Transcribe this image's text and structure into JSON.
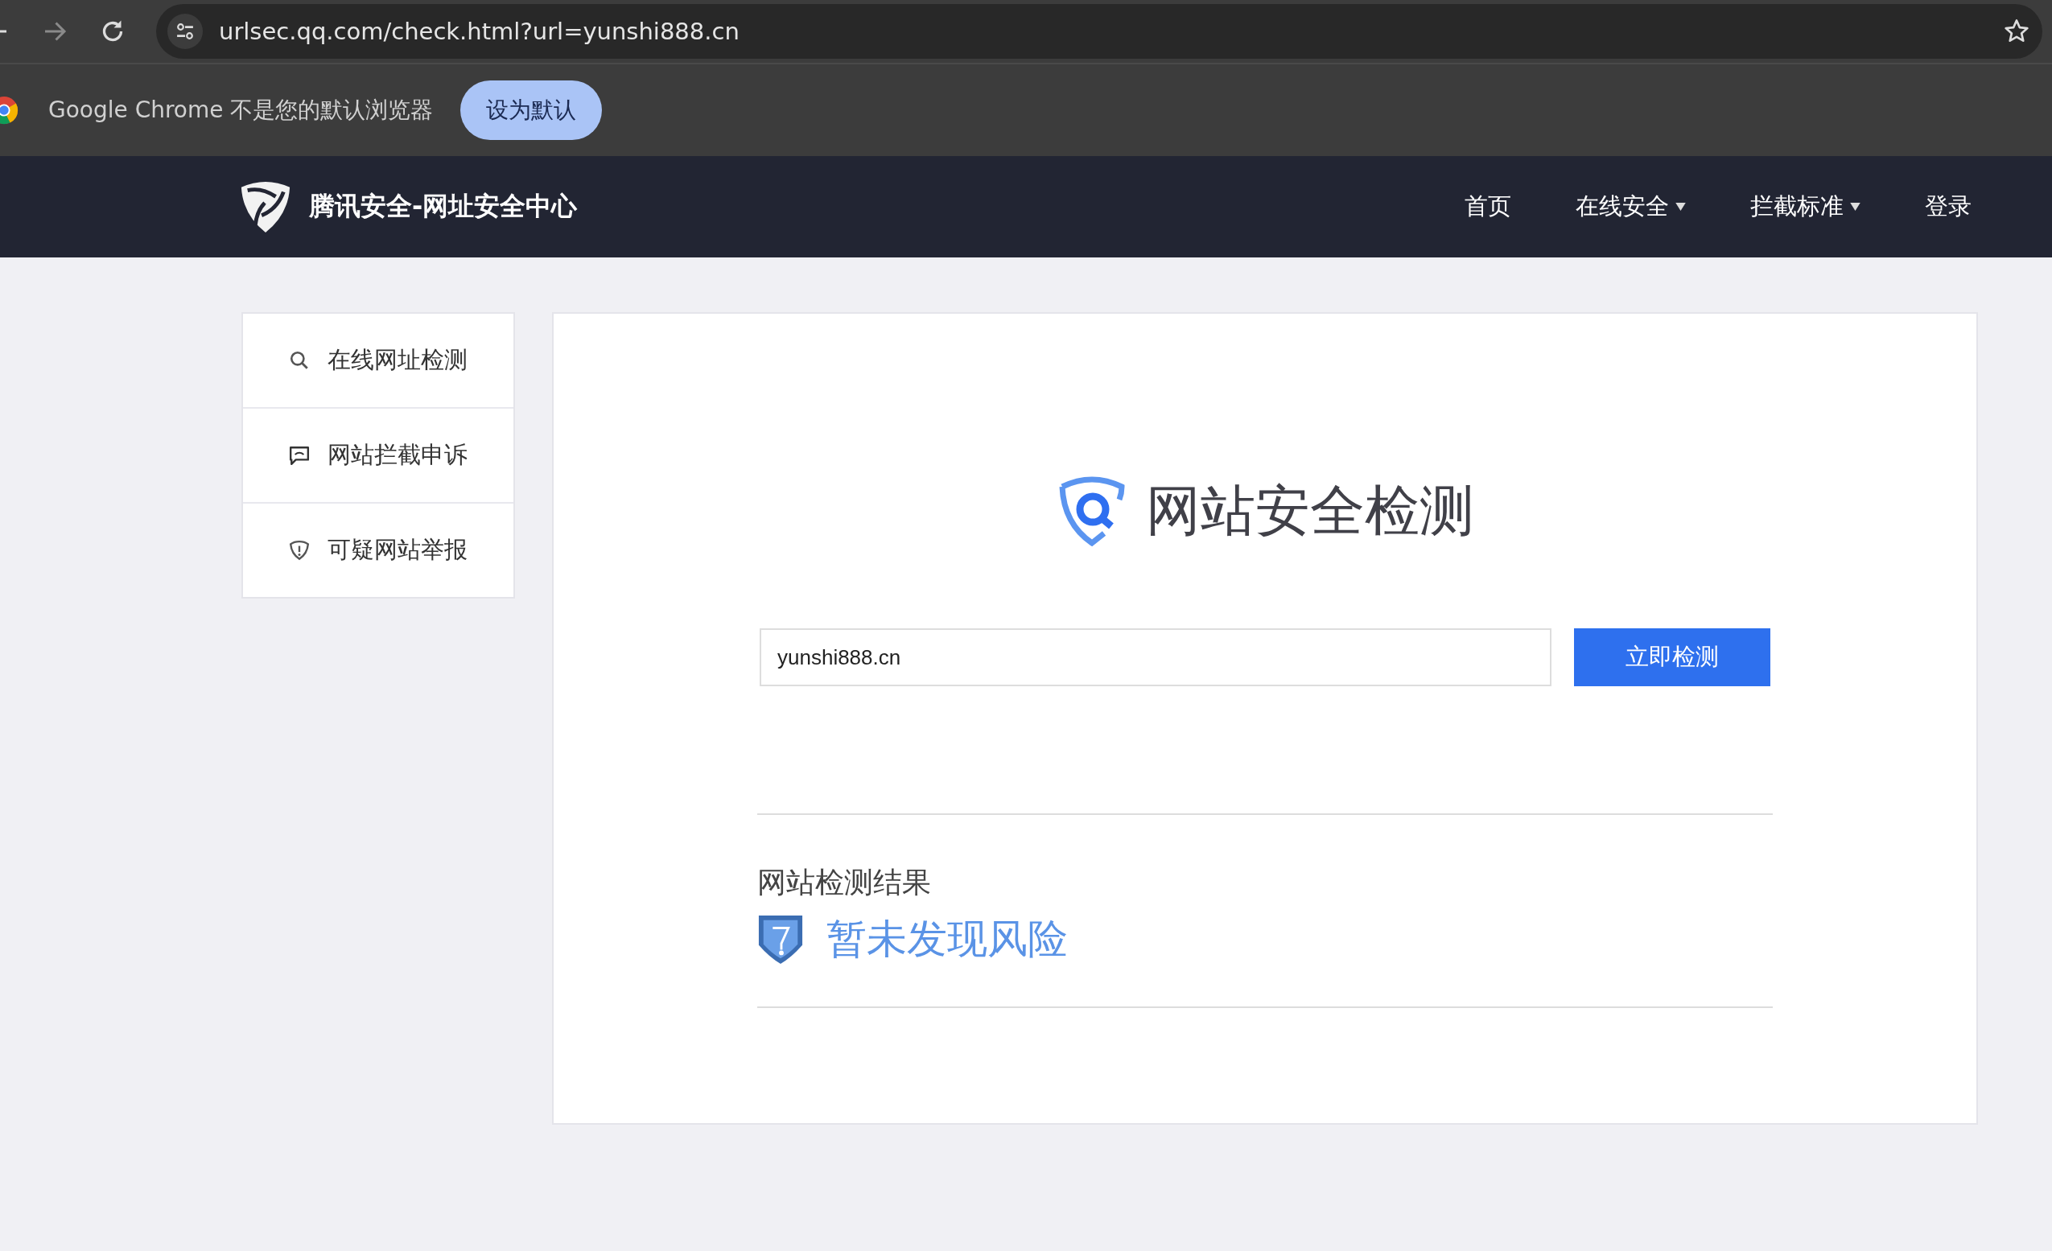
{
  "browser": {
    "url": "urlsec.qq.com/check.html?url=yunshi888.cn",
    "back_disabled": false,
    "forward_disabled": true
  },
  "infobar": {
    "message": "Google Chrome 不是您的默认浏览器",
    "button": "设为默认"
  },
  "site_header": {
    "brand": "腾讯安全-网址安全中心",
    "nav": [
      {
        "label": "首页",
        "kind": "link"
      },
      {
        "label": "在线安全",
        "kind": "dropdown"
      },
      {
        "label": "拦截标准",
        "kind": "dropdown"
      },
      {
        "label": "登录",
        "kind": "link"
      }
    ]
  },
  "sidebar": {
    "items": [
      {
        "label": "在线网址检测",
        "kind": "search"
      },
      {
        "label": "网站拦截申诉",
        "kind": "comment"
      },
      {
        "label": "可疑网站举报",
        "kind": "report"
      }
    ]
  },
  "main": {
    "title": "网站安全检测",
    "url_input": {
      "value": "yunshi888.cn"
    },
    "check_button": "立即检测",
    "result": {
      "heading": "网站检测结果",
      "status": "暂未发现风险"
    }
  }
}
